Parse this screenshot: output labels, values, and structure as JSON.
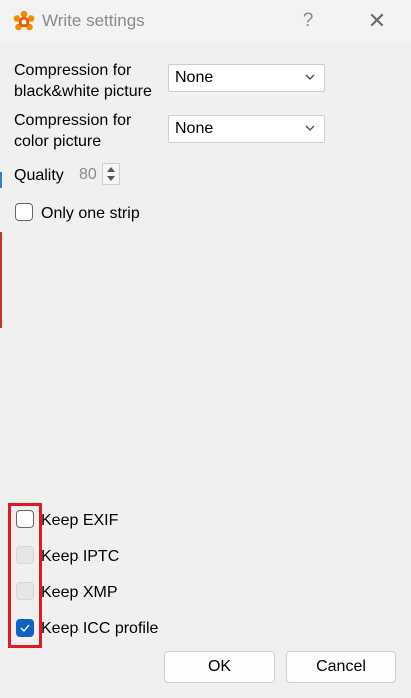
{
  "window": {
    "title": "Write settings",
    "help_label": "?",
    "close_label": "✕"
  },
  "form": {
    "bw_compression_label_line1": "Compression for",
    "bw_compression_label_line2": "black&white picture",
    "bw_compression_value": "None",
    "color_compression_label_line1": "Compression for",
    "color_compression_label_line2": "color picture",
    "color_compression_value": "None",
    "quality_label": "Quality",
    "quality_value": "80",
    "only_one_strip_label": "Only one strip",
    "only_one_strip_checked": false
  },
  "metadata": {
    "keep_exif_label": "Keep EXIF",
    "keep_exif_checked": false,
    "keep_iptc_label": "Keep IPTC",
    "keep_iptc_enabled": false,
    "keep_xmp_label": "Keep XMP",
    "keep_xmp_enabled": false,
    "keep_icc_label": "Keep ICC profile",
    "keep_icc_checked": true
  },
  "buttons": {
    "ok_label": "OK",
    "cancel_label": "Cancel"
  },
  "colors": {
    "accent": "#0f62c0",
    "highlight": "#e01a22"
  }
}
